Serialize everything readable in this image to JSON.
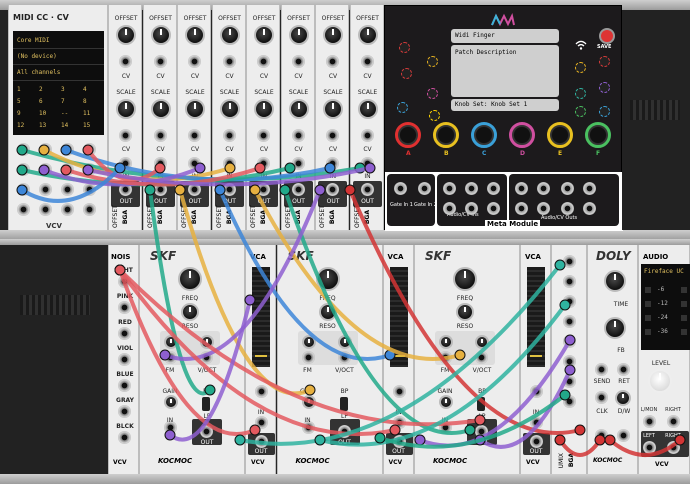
{
  "midi_module": {
    "title": "MIDI CC · CV",
    "driver": "Core MIDI",
    "device": "(No device)",
    "channel": "All channels",
    "cc_numbers": [
      "1",
      "2",
      "3",
      "4",
      "5",
      "6",
      "7",
      "8",
      "9",
      "10",
      "--",
      "11",
      "12",
      "13",
      "14",
      "15"
    ],
    "brand": "VCV"
  },
  "offset_modules": {
    "offset_label": "OFFSET",
    "scale_label": "SCALE",
    "cv_label": "CV",
    "in_label": "IN",
    "out_label": "OUT",
    "side_label": "OFFSET",
    "brand": "BGA",
    "count": 8
  },
  "meta_module": {
    "patch_name": "Widi Finger",
    "patch_description": "Patch Description",
    "knob_set": "Knob Set: Knob Set 1",
    "save_label": "SAVE",
    "knob_letters": [
      "A",
      "B",
      "C",
      "D",
      "E",
      "F"
    ],
    "gate_in_1": "Gate In 1",
    "gate_in_2": "Gate In 2",
    "audio_cv_ins": "Audio/CV Ins",
    "title": "Meta Module",
    "audio_cv_outs": "Audio/CV Outs"
  },
  "bottom_row": {
    "nois_title": "NOIS",
    "nois_labels": [
      "WHT",
      "PINK",
      "RED",
      "VIOL",
      "BLUE",
      "GRAY",
      "BLCK"
    ],
    "skf_title": "SKF",
    "vca_title": "VCA",
    "freq_label": "FREQ",
    "reso_label": "RESO",
    "fm_label": "FM",
    "voct_label": "V/OCT",
    "gain_label": "GAIN",
    "bp_label": "BP",
    "lp_label": "LP",
    "in_label": "IN",
    "out_label": "OUT",
    "kocmoc": "KOCMOC",
    "vcv": "VCV",
    "umix_label": "UMIX",
    "bga": "BGA",
    "doly_title": "DOLY",
    "time_label": "TIME",
    "fb_label": "FB",
    "send_label": "SEND",
    "ret_label": "RET",
    "clk_label": "CLK",
    "dw_label": "D/W",
    "audio_title": "AUDIO",
    "audio_device": "Fireface UC",
    "meter_labels": [
      "-6",
      "-12",
      "-24",
      "-36"
    ],
    "level_label": "LEVEL",
    "lmon_label": "L/MON",
    "right_label": "RIGHT",
    "left_label": "LEFT"
  },
  "cable_colors": [
    "#22a98a",
    "#e6b040",
    "#8e5fd0",
    "#e3595f",
    "#3d86d8",
    "#2fb3a0",
    "#d23535"
  ]
}
